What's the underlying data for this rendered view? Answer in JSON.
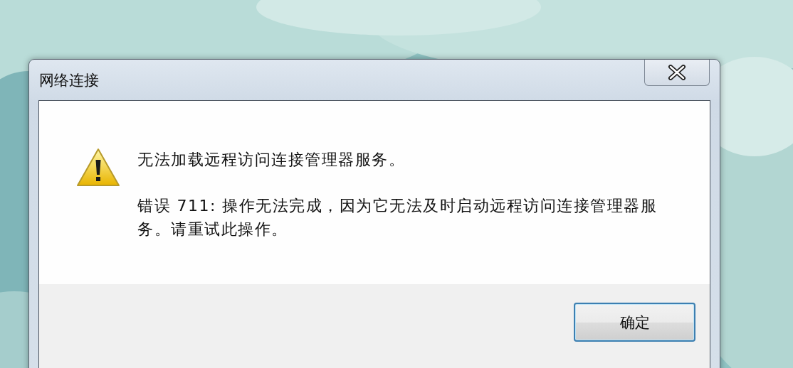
{
  "window": {
    "title": "网络连接"
  },
  "message": {
    "heading": "无法加载远程访问连接管理器服务。",
    "detail": "错误 711: 操作无法完成，因为它无法及时启动远程访问连接管理器服务。请重试此操作。"
  },
  "buttons": [
    {
      "label": "确定",
      "default": true
    }
  ]
}
